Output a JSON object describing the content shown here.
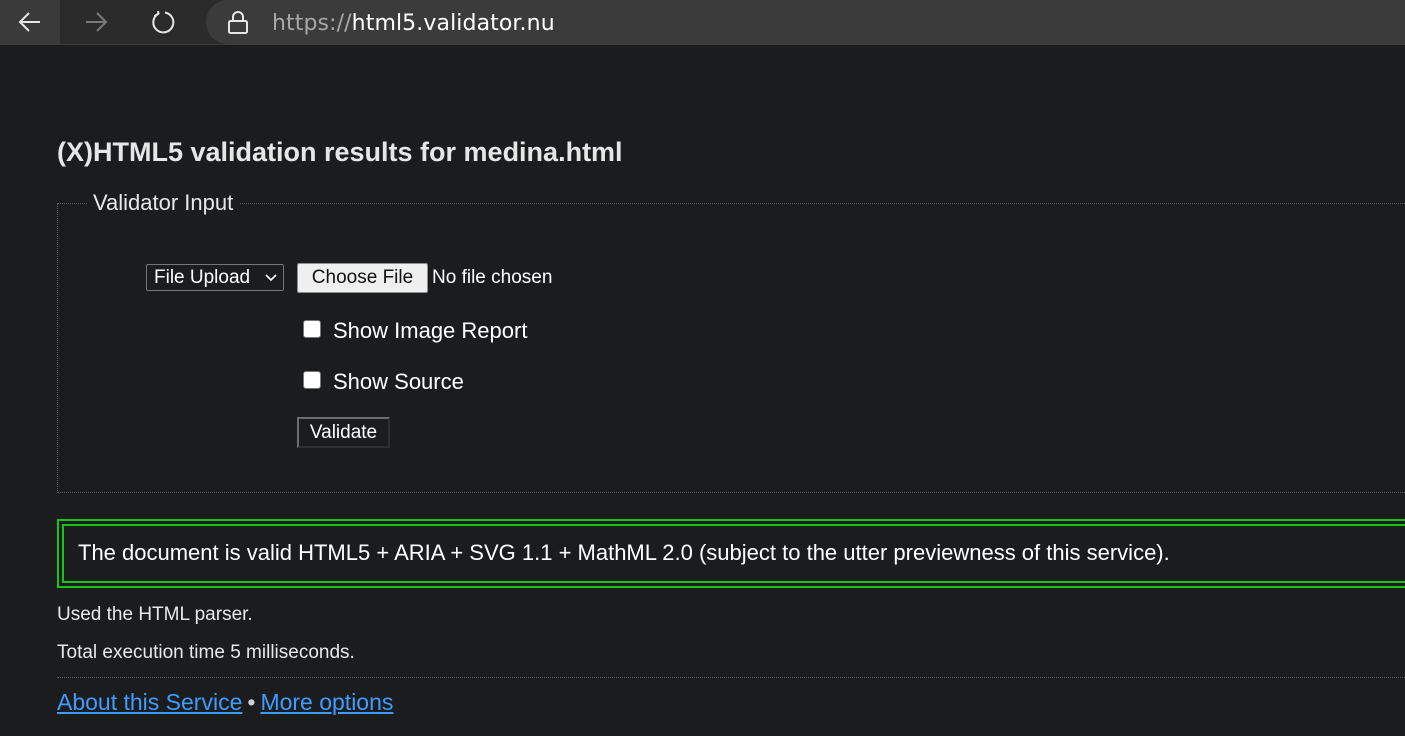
{
  "browser": {
    "url_scheme": "https://",
    "url_host": "html5.validator.nu",
    "icons": {
      "back": "back-arrow-icon",
      "forward": "forward-arrow-icon",
      "reload": "reload-icon",
      "lock": "lock-icon"
    }
  },
  "page": {
    "title": "(X)HTML5 validation results for medina.html",
    "input_section": {
      "legend": "Validator Input",
      "mode_select_value": "File Upload",
      "file_button_label": "Choose File",
      "file_status": "No file chosen",
      "options": [
        {
          "label": "Show Image Report",
          "checked": false
        },
        {
          "label": "Show Source",
          "checked": false
        }
      ],
      "submit_label": "Validate"
    },
    "result_message": "The document is valid HTML5 + ARIA + SVG 1.1 + MathML 2.0 (subject to the utter previewness of this service).",
    "parser_note": "Used the HTML parser.",
    "time_note": "Total execution time 5 milliseconds.",
    "footer": {
      "about_link": "About this Service",
      "separator": "•",
      "options_link": "More options"
    }
  },
  "colors": {
    "page_background": "#1b1c1e",
    "success_border": "#18c418",
    "link": "#3f9cff"
  }
}
